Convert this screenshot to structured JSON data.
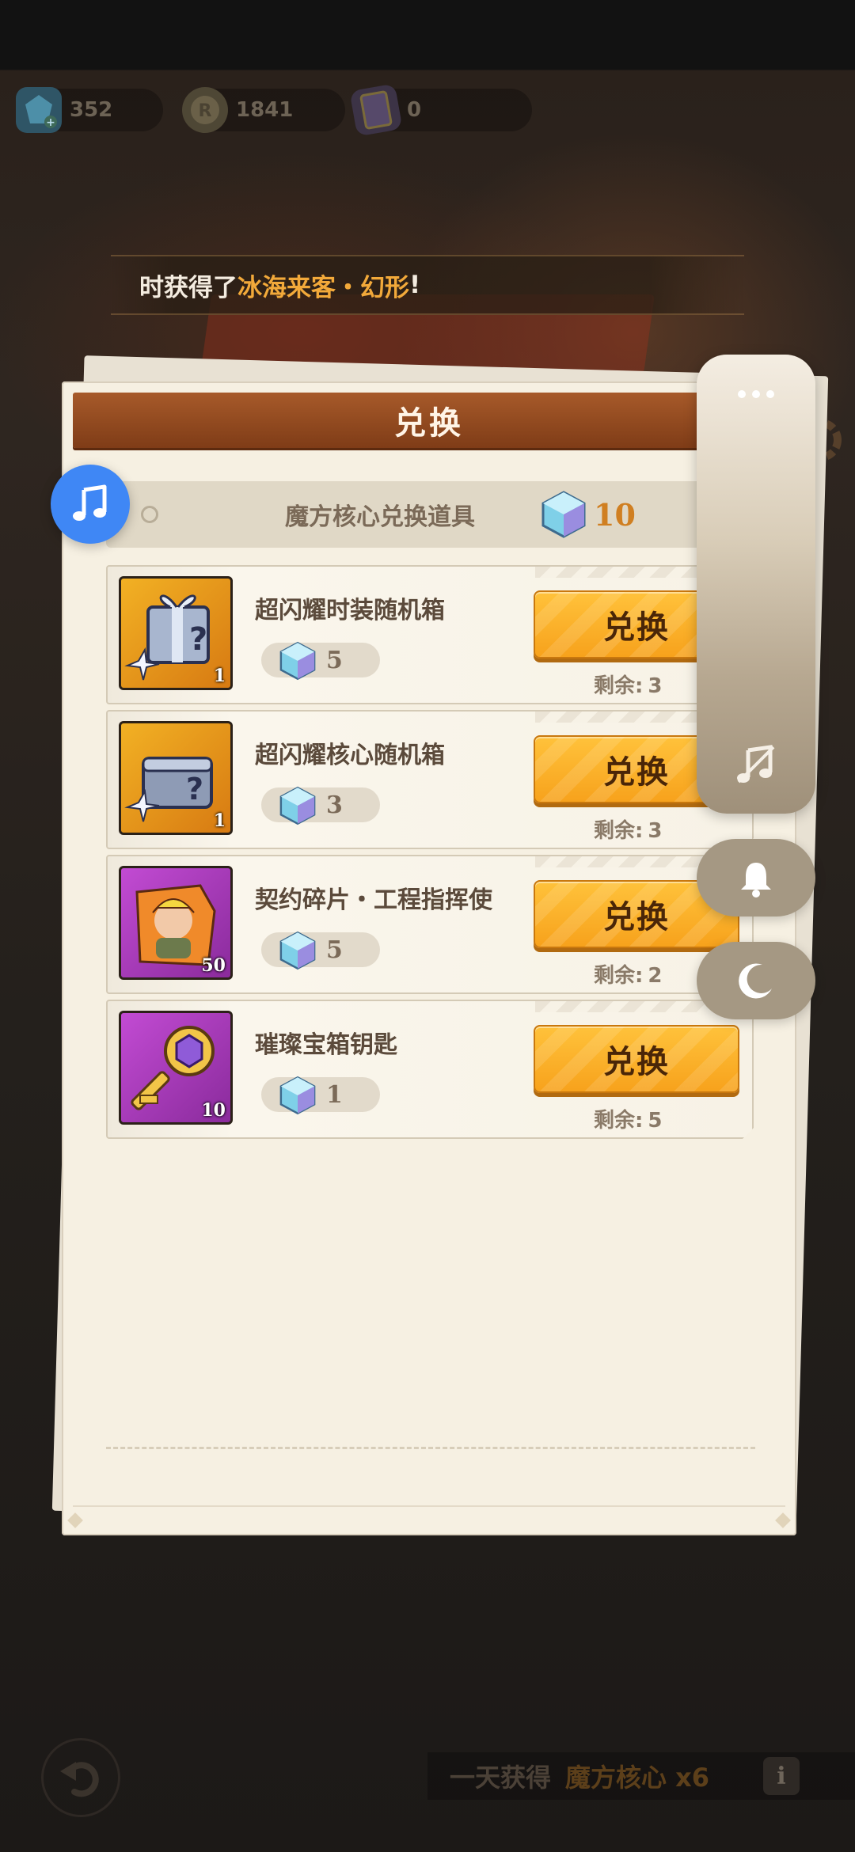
{
  "currencies": [
    {
      "icon": "gem-plus-icon",
      "value": "352",
      "color": "#3a6f86"
    },
    {
      "icon": "coin-plus-icon",
      "value": "1841",
      "color": "#6d6355"
    },
    {
      "icon": "card-icon",
      "value": "0",
      "color": "#6d6355"
    }
  ],
  "banner": {
    "prefix": "时获得了",
    "highlight": "冰海来客・幻形",
    "suffix": "!"
  },
  "dialog": {
    "title": "兑换",
    "core_label": "魔方核心兑换道具",
    "core_count": "10",
    "items": [
      {
        "name": "超闪耀时装随机箱",
        "qty": "1",
        "cost": "5",
        "button": "兑换",
        "remain_label": "剩余:",
        "remain": "3",
        "thumb": "costume-box",
        "frame": "#e4a11d"
      },
      {
        "name": "超闪耀核心随机箱",
        "qty": "1",
        "cost": "3",
        "button": "兑换",
        "remain_label": "剩余:",
        "remain": "3",
        "thumb": "core-box",
        "frame": "#e4a11d"
      },
      {
        "name": "契约碎片・工程指挥使",
        "qty": "50",
        "cost": "5",
        "button": "兑换",
        "remain_label": "剩余:",
        "remain": "2",
        "thumb": "contract-shard",
        "frame": "#b63bc4"
      },
      {
        "name": "璀璨宝箱钥匙",
        "qty": "10",
        "cost": "1",
        "button": "兑换",
        "remain_label": "剩余:",
        "remain": "5",
        "thumb": "chest-key",
        "frame": "#b63bc4"
      }
    ]
  },
  "bottom": {
    "text": "一天获得",
    "reward": "魔方核心 x6",
    "info": "i"
  },
  "colors": {
    "accent": "#f7a21c",
    "header": "#8f4a1f",
    "fab": "#3f87f5"
  }
}
